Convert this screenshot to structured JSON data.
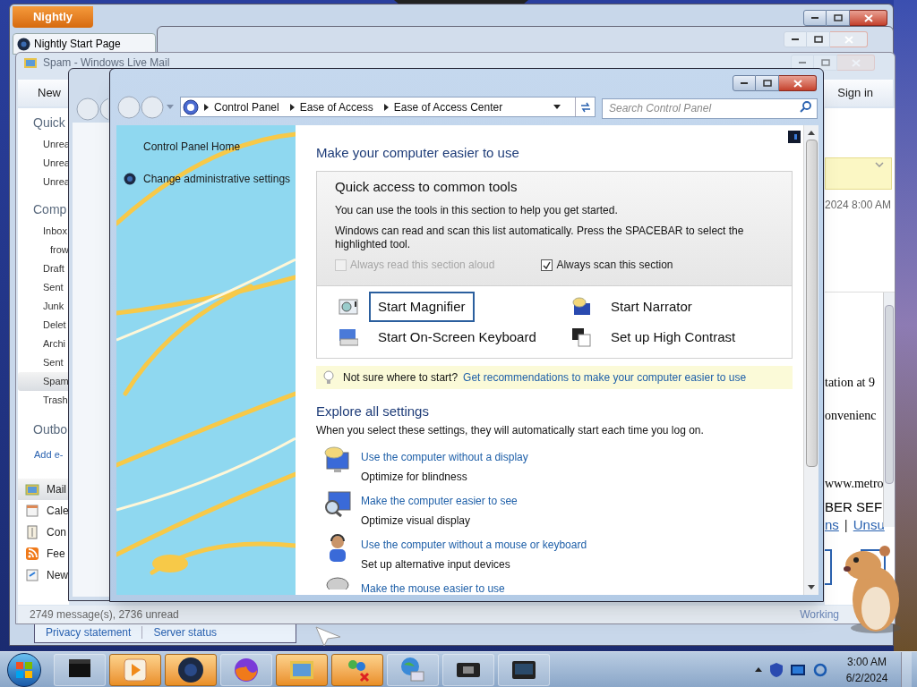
{
  "browser_window": {
    "menu_button": "Nightly",
    "tab": "Nightly Start Page",
    "footer_links": [
      "Privacy statement",
      "Server status"
    ]
  },
  "mail_window": {
    "title": "Spam - Windows Live Mail",
    "toolbar_button": "New",
    "sign_in": "Sign in",
    "quick_views": {
      "heading": "Quick",
      "items": [
        "Unrea",
        "Unrea",
        "Unrea"
      ]
    },
    "account": {
      "heading": "Comp",
      "folders": [
        {
          "label": "Inbox",
          "selected": false,
          "children": [
            {
              "label": "frow",
              "selected": false
            }
          ]
        },
        {
          "label": "Draft",
          "selected": false
        },
        {
          "label": "Sent",
          "selected": false
        },
        {
          "label": "Junk",
          "selected": false
        },
        {
          "label": "Delet",
          "selected": false
        },
        {
          "label": "Archi",
          "selected": false
        },
        {
          "label": "Sent",
          "selected": false
        },
        {
          "label": "Spam",
          "selected": true
        },
        {
          "label": "Trash",
          "selected": false
        }
      ]
    },
    "outbox": "Outbo",
    "add_account": "Add e-",
    "nav": [
      {
        "label": "Mail",
        "selected": true
      },
      {
        "label": "Cale",
        "selected": false
      },
      {
        "label": "Con",
        "selected": false
      },
      {
        "label": "Fee",
        "selected": false
      },
      {
        "label": "New",
        "selected": false
      }
    ],
    "message_date": "2024 8:00 AM",
    "message_lines": [
      "tation at 9",
      "onvenienc",
      "www.metro",
      "BER SEF"
    ],
    "message_links": [
      "ns",
      "Unsu"
    ],
    "link_separator": "|",
    "status": "2749 message(s), 2736 unread",
    "status_right": "Working"
  },
  "control_panel": {
    "breadcrumbs": [
      "Control Panel",
      "Ease of Access",
      "Ease of Access Center"
    ],
    "search": {
      "placeholder": "Search Control Panel"
    },
    "sidebar": [
      "Control Panel Home",
      "Change administrative settings"
    ],
    "heading": "Make your computer easier to use",
    "quick_access": {
      "title": "Quick access to common tools",
      "lines": [
        "You can use the tools in this section to help you get started.",
        "Windows can read and scan this list automatically.  Press the SPACEBAR to select the highlighted tool."
      ],
      "checkboxes": [
        {
          "label": "Always read this section aloud",
          "checked": false,
          "disabled": true
        },
        {
          "label": "Always scan this section",
          "checked": true,
          "disabled": false
        }
      ],
      "tools": [
        {
          "label": "Start Magnifier",
          "focused": true
        },
        {
          "label": "Start Narrator",
          "focused": false
        },
        {
          "label": "Start On-Screen Keyboard",
          "focused": false
        },
        {
          "label": "Set up High Contrast",
          "focused": false
        }
      ]
    },
    "tip": {
      "text": "Not sure where to start?",
      "link": "Get recommendations to make your computer easier to use"
    },
    "explore": {
      "heading": "Explore all settings",
      "description": "When you select these settings, they will automatically start each time you log on.",
      "items": [
        {
          "link": "Use the computer without a display",
          "description": "Optimize for blindness"
        },
        {
          "link": "Make the computer easier to see",
          "description": "Optimize visual display"
        },
        {
          "link": "Use the computer without a mouse or keyboard",
          "description": "Set up alternative input devices"
        },
        {
          "link": "Make the mouse easier to use"
        }
      ]
    }
  },
  "taskbar": {
    "buttons": [
      {
        "highlighted": false
      },
      {
        "highlighted": true
      },
      {
        "highlighted": true
      },
      {
        "highlighted": false
      },
      {
        "highlighted": true
      },
      {
        "highlighted": true
      },
      {
        "highlighted": false
      },
      {
        "highlighted": false
      },
      {
        "highlighted": false
      }
    ],
    "time": "3:00 AM",
    "date": "6/2/2024"
  }
}
